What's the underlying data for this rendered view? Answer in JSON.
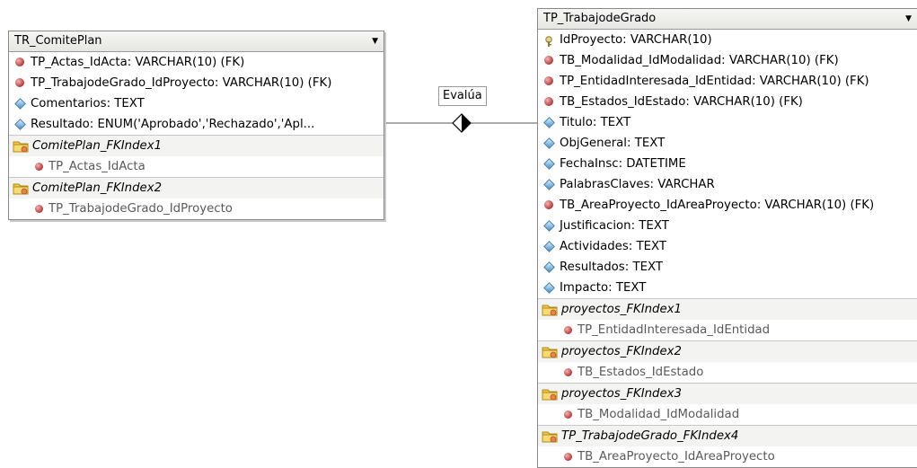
{
  "relationship": {
    "label": "Evalúa"
  },
  "tables": {
    "comite": {
      "title": "TR_ComitePlan",
      "columns": [
        {
          "text": "TP_Actas_IdActa: VARCHAR(10) (FK)",
          "icon": "foreign-key-icon"
        },
        {
          "text": "TP_TrabajodeGrado_IdProyecto: VARCHAR(10) (FK)",
          "icon": "foreign-key-icon"
        },
        {
          "text": "Comentarios: TEXT",
          "icon": "attribute-icon"
        },
        {
          "text": "Resultado: ENUM('Aprobado','Rechazado','Apl...",
          "icon": "attribute-icon"
        }
      ],
      "indexes": [
        {
          "name": "ComitePlan_FKIndex1",
          "field": "TP_Actas_IdActa"
        },
        {
          "name": "ComitePlan_FKIndex2",
          "field": "TP_TrabajodeGrado_IdProyecto"
        }
      ]
    },
    "trabajo": {
      "title": "TP_TrabajodeGrado",
      "columns": [
        {
          "text": "IdProyecto: VARCHAR(10)",
          "icon": "primary-key-icon"
        },
        {
          "text": "TB_Modalidad_IdModalidad: VARCHAR(10) (FK)",
          "icon": "foreign-key-icon"
        },
        {
          "text": "TP_EntidadInteresada_IdEntidad: VARCHAR(10) (FK)",
          "icon": "foreign-key-icon"
        },
        {
          "text": "TB_Estados_IdEstado: VARCHAR(10) (FK)",
          "icon": "foreign-key-icon"
        },
        {
          "text": "Titulo: TEXT",
          "icon": "attribute-icon"
        },
        {
          "text": "ObjGeneral: TEXT",
          "icon": "attribute-icon"
        },
        {
          "text": "FechaInsc: DATETIME",
          "icon": "attribute-icon"
        },
        {
          "text": "PalabrasClaves: VARCHAR",
          "icon": "attribute-icon"
        },
        {
          "text": "TB_AreaProyecto_IdAreaProyecto: VARCHAR(10) (FK)",
          "icon": "foreign-key-icon"
        },
        {
          "text": "Justificacion: TEXT",
          "icon": "attribute-icon"
        },
        {
          "text": "Actividades: TEXT",
          "icon": "attribute-icon"
        },
        {
          "text": "Resultados: TEXT",
          "icon": "attribute-icon"
        },
        {
          "text": "Impacto: TEXT",
          "icon": "attribute-icon"
        }
      ],
      "indexes": [
        {
          "name": "proyectos_FKIndex1",
          "field": "TP_EntidadInteresada_IdEntidad"
        },
        {
          "name": "proyectos_FKIndex2",
          "field": "TB_Estados_IdEstado"
        },
        {
          "name": "proyectos_FKIndex3",
          "field": "TB_Modalidad_IdModalidad"
        },
        {
          "name": "TP_TrabajodeGrado_FKIndex4",
          "field": "TB_AreaProyecto_IdAreaProyecto"
        }
      ]
    }
  }
}
